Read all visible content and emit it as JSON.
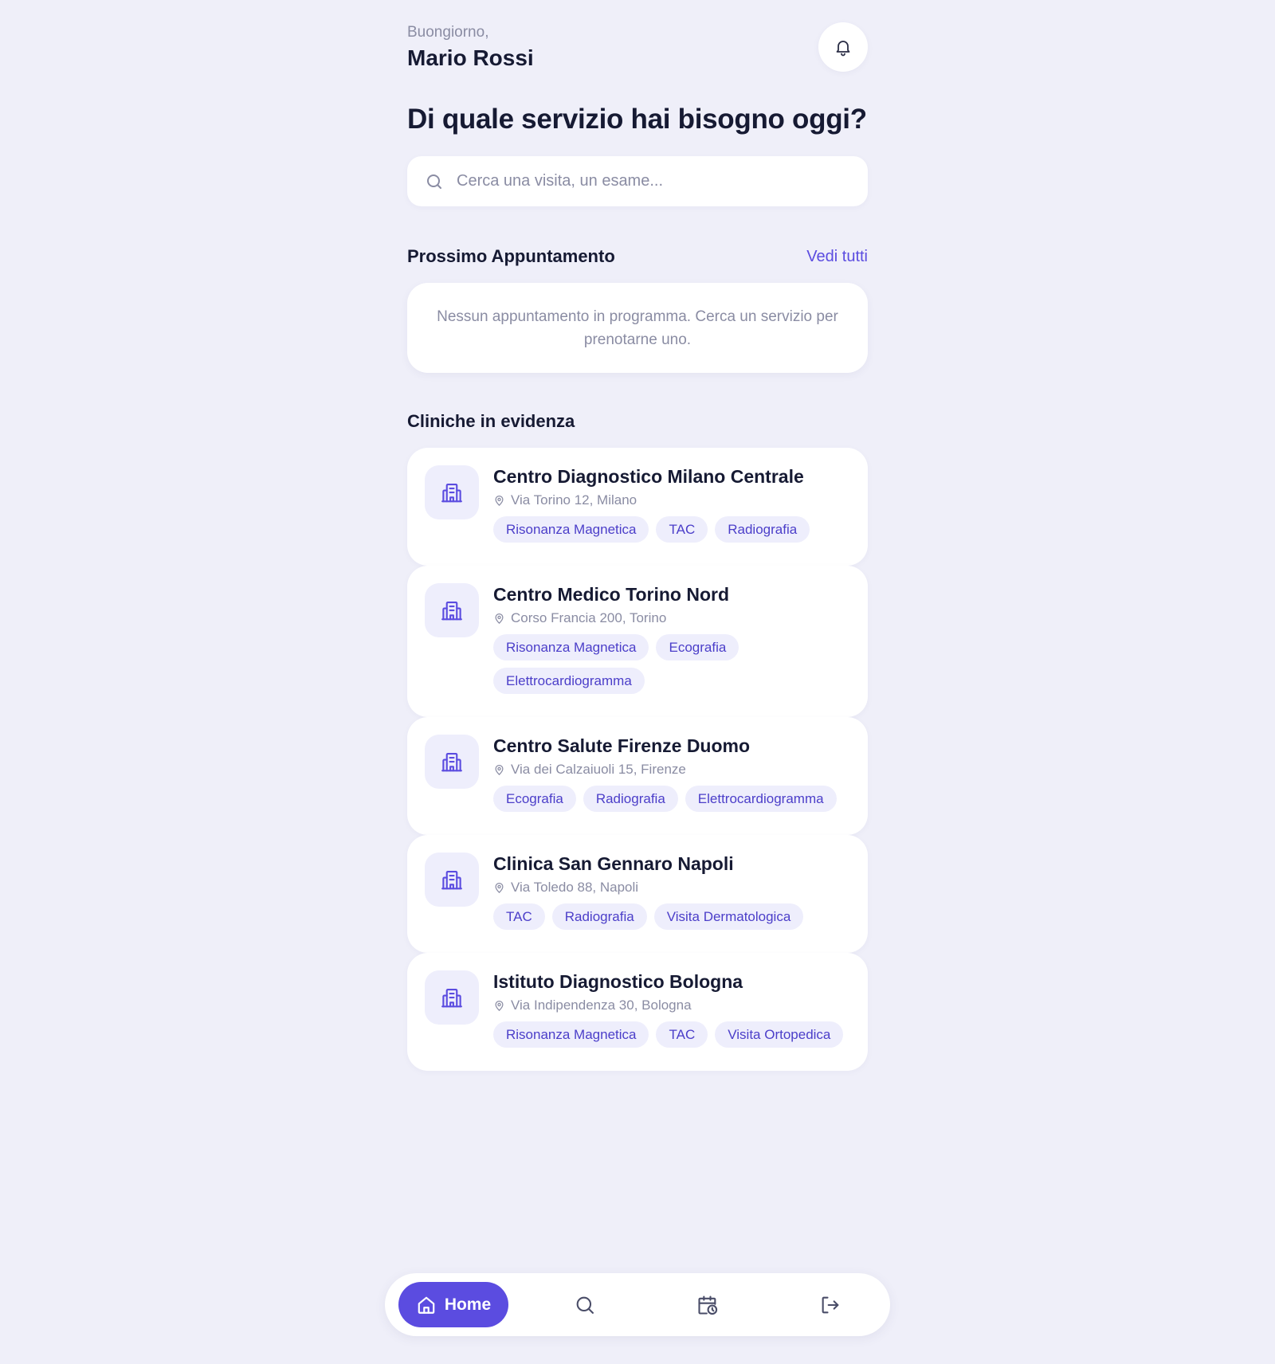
{
  "header": {
    "greeting": "Buongiorno,",
    "user_name": "Mario Rossi",
    "notification_icon": "bell-icon"
  },
  "headline": "Di quale servizio hai bisogno oggi?",
  "search": {
    "placeholder": "Cerca una visita, un esame...",
    "value": "",
    "icon": "search-icon"
  },
  "next_appointment": {
    "title": "Prossimo Appuntamento",
    "see_all_label": "Vedi tutti",
    "empty_message": "Nessun appuntamento in programma. Cerca un servizio per prenotarne uno."
  },
  "featured_clinics": {
    "title": "Cliniche in evidenza",
    "items": [
      {
        "name": "Centro Diagnostico Milano Centrale",
        "address": "Via Torino 12, Milano",
        "tags": [
          "Risonanza Magnetica",
          "TAC",
          "Radiografia"
        ]
      },
      {
        "name": "Centro Medico Torino Nord",
        "address": "Corso Francia 200, Torino",
        "tags": [
          "Risonanza Magnetica",
          "Ecografia",
          "Elettrocardiogramma"
        ]
      },
      {
        "name": "Centro Salute Firenze Duomo",
        "address": "Via dei Calzaiuoli 15, Firenze",
        "tags": [
          "Ecografia",
          "Radiografia",
          "Elettrocardiogramma"
        ]
      },
      {
        "name": "Clinica San Gennaro Napoli",
        "address": "Via Toledo 88, Napoli",
        "tags": [
          "TAC",
          "Radiografia",
          "Visita Dermatologica"
        ]
      },
      {
        "name": "Istituto Diagnostico Bologna",
        "address": "Via Indipendenza 30, Bologna",
        "tags": [
          "Risonanza Magnetica",
          "TAC",
          "Visita Ortopedica"
        ]
      }
    ]
  },
  "bottom_nav": {
    "home_label": "Home",
    "items": [
      "home-icon",
      "search-icon",
      "calendar-clock-icon",
      "logout-icon"
    ]
  },
  "colors": {
    "accent": "#5b4ce0",
    "background": "#efeff9",
    "tag_background": "#eeeefc",
    "tag_text": "#4b3ec9",
    "muted_text": "#8a8ca3"
  }
}
